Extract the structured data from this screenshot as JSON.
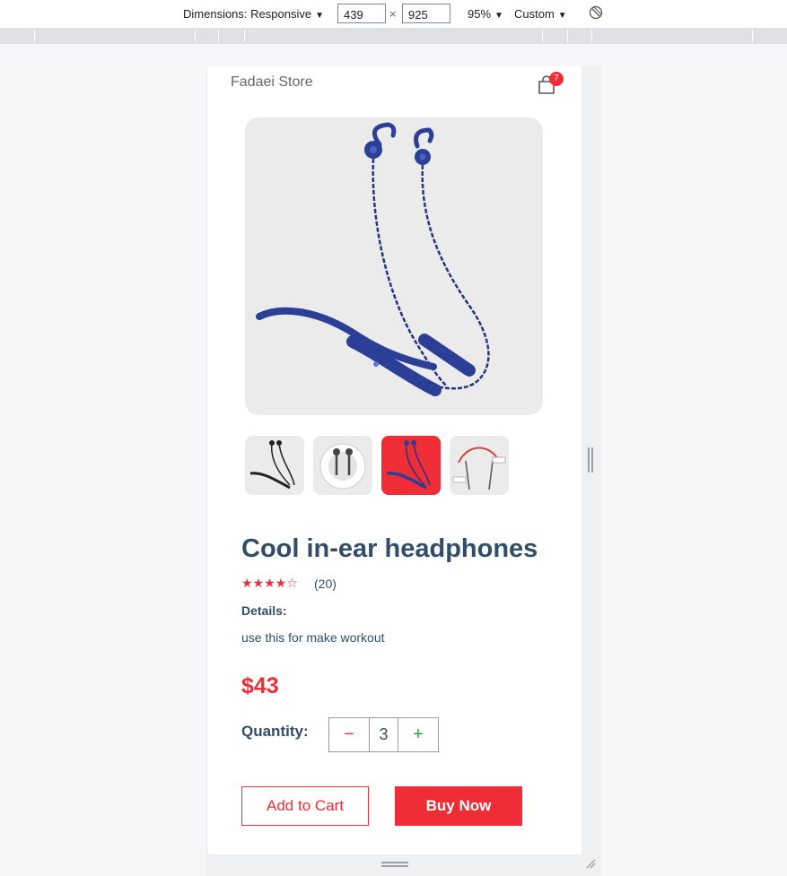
{
  "devtools": {
    "dimensions_label": "Dimensions: Responsive",
    "width_value": "439",
    "height_value": "925",
    "times": "×",
    "zoom": "95%",
    "throttle": "Custom",
    "caret": "▼"
  },
  "header": {
    "brand": "Fadaei Store",
    "cart_count": "7"
  },
  "product": {
    "title": "Cool in-ear headphones",
    "stars": "★★★★☆",
    "rating_value": 4,
    "reviews": "(20)",
    "details_heading": "Details:",
    "details_text": "use this for make workout",
    "price": "$43",
    "quantity_label": "Quantity:",
    "minus": "−",
    "quantity": "3",
    "plus": "+",
    "add_to_cart": "Add to Cart",
    "buy_now": "Buy Now"
  },
  "colors": {
    "accent": "#ef2d37",
    "text": "#324d67",
    "plus": "#31a831",
    "headphone": "#2b3f96"
  },
  "icons": [
    "cart-icon",
    "rotate-icon",
    "earphone-image"
  ]
}
